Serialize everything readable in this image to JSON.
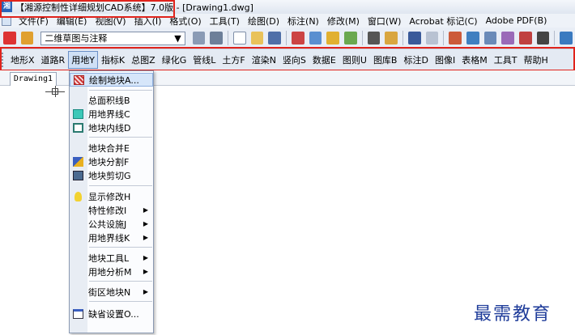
{
  "window": {
    "title": "【湘源控制性详细规划CAD系统】7.0版 - [Drawing1.dwg]",
    "app_icon_glyph": "湘"
  },
  "menubar": {
    "items": [
      "文件(F)",
      "编辑(E)",
      "视图(V)",
      "插入(I)",
      "格式(O)",
      "工具(T)",
      "绘图(D)",
      "标注(N)",
      "修改(M)",
      "窗口(W)",
      "Acrobat 标记(C)",
      "Adobe PDF(B)"
    ]
  },
  "toolbar": {
    "layer_value": "二维草图与注释"
  },
  "command_bar": {
    "items": [
      "地形X",
      "道路R",
      "用地Y",
      "指标K",
      "总图Z",
      "绿化G",
      "管线L",
      "土方F",
      "渲染N",
      "竖向S",
      "数据E",
      "图则U",
      "图库B",
      "标注D",
      "图像I",
      "表格M",
      "工具T",
      "帮助H"
    ],
    "active_index": 2
  },
  "document": {
    "tab_label": "Drawing1"
  },
  "dropdown": {
    "items": [
      {
        "label": "绘制地块A...",
        "icon": "hatch-icon",
        "submenu": false,
        "highlighted": true
      },
      {
        "label": "总面积线B",
        "icon": "",
        "submenu": false
      },
      {
        "label": "用地界线C",
        "icon": "boundary-icon",
        "submenu": false
      },
      {
        "label": "地块内线D",
        "icon": "inner-line-icon",
        "submenu": false
      },
      {
        "label": "地块合并E",
        "icon": "",
        "submenu": false
      },
      {
        "label": "地块分割F",
        "icon": "split-icon",
        "submenu": false
      },
      {
        "label": "地块剪切G",
        "icon": "cut-icon",
        "submenu": false
      },
      {
        "label": "显示修改H",
        "icon": "bulb-icon",
        "submenu": false
      },
      {
        "label": "特性修改I",
        "icon": "",
        "submenu": true
      },
      {
        "label": "公共设施J",
        "icon": "",
        "submenu": true
      },
      {
        "label": "用地界线K",
        "icon": "",
        "submenu": true
      },
      {
        "label": "地块工具L",
        "icon": "",
        "submenu": true
      },
      {
        "label": "用地分析M",
        "icon": "",
        "submenu": true
      },
      {
        "label": "街区地块N",
        "icon": "",
        "submenu": true
      },
      {
        "label": "缺省设置O...",
        "icon": "settings-icon",
        "submenu": false
      }
    ]
  },
  "watermark": {
    "text": "最需教育"
  },
  "colors": {
    "annotation_red": "#e0231c",
    "highlight": "#d6e6fa",
    "watermark": "#1f3c9a"
  }
}
